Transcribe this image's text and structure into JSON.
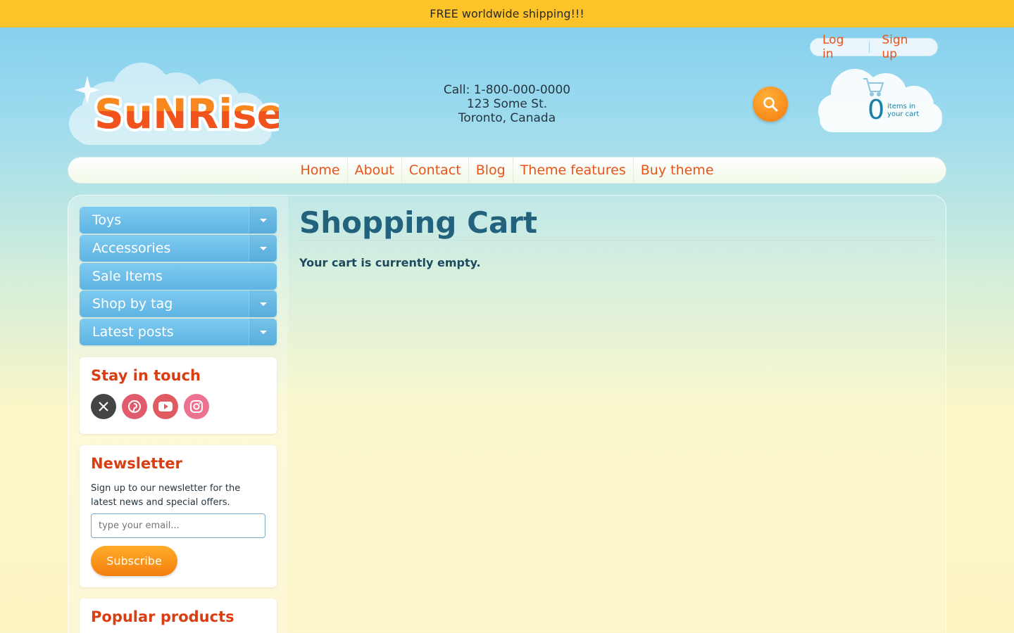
{
  "announcement": "FREE worldwide shipping!!!",
  "account": {
    "login": "Log in",
    "signup": "Sign up"
  },
  "logo": {
    "text": "SuNRise"
  },
  "contact": {
    "phone": "Call: 1-800-000-0000",
    "street": "123 Some St.",
    "city": "Toronto, Canada"
  },
  "search": {
    "icon": "search-icon"
  },
  "cart": {
    "count": "0",
    "line1": "items in",
    "line2": "your cart",
    "icon": "cart-icon"
  },
  "nav": [
    {
      "label": "Home"
    },
    {
      "label": "About"
    },
    {
      "label": "Contact"
    },
    {
      "label": "Blog"
    },
    {
      "label": "Theme features"
    },
    {
      "label": "Buy theme"
    }
  ],
  "sidebar": {
    "categories": [
      {
        "label": "Toys",
        "expandable": true
      },
      {
        "label": "Accessories",
        "expandable": true
      },
      {
        "label": "Sale Items",
        "expandable": false
      },
      {
        "label": "Shop by tag",
        "expandable": true
      },
      {
        "label": "Latest posts",
        "expandable": true
      }
    ],
    "stay_in_touch": {
      "title": "Stay in touch",
      "networks": [
        "x-icon",
        "pinterest-icon",
        "youtube-icon",
        "instagram-icon"
      ]
    },
    "newsletter": {
      "title": "Newsletter",
      "text": "Sign up to our newsletter for the latest news and special offers.",
      "placeholder": "type your email...",
      "button": "Subscribe"
    },
    "popular": {
      "title": "Popular products"
    }
  },
  "main": {
    "title": "Shopping Cart",
    "message": "Your cart is currently empty."
  },
  "colors": {
    "accent": "#e8531a",
    "topbar": "#fdc42a",
    "category": "#6cbfe9",
    "title": "#22627d"
  }
}
